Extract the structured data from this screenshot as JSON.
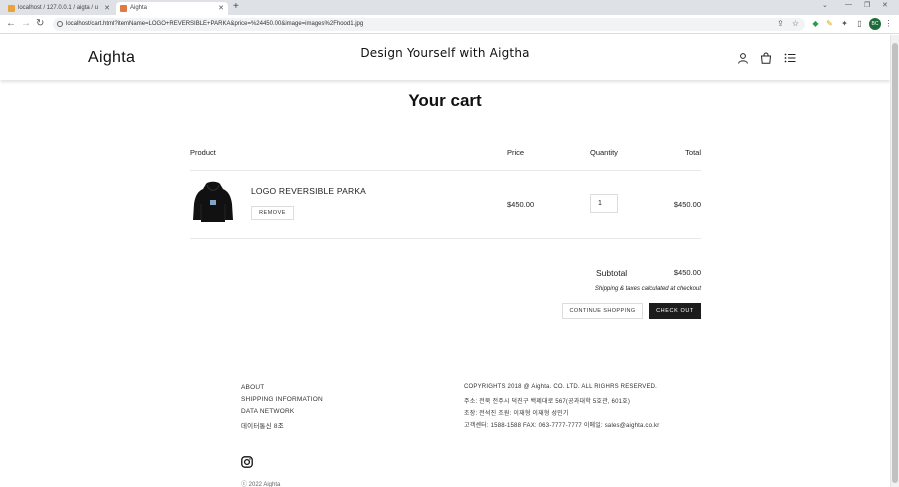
{
  "browser": {
    "tabs": [
      {
        "title": "localhost / 127.0.0.1 / aigta / u",
        "active": false
      },
      {
        "title": "Aighta",
        "active": true
      }
    ],
    "url": "localhost/cart.html?itemName=LOGO+REVERSIBLE+PARKA&price=%24450.00&image=images%2Fhood1.jpg",
    "profile_initials": "BC"
  },
  "header": {
    "logo": "Aighta",
    "tagline": "Design Yourself with Aigtha",
    "icons": [
      "user-icon",
      "bag-icon",
      "menu-list-icon"
    ]
  },
  "cart": {
    "title": "Your cart",
    "columns": {
      "product": "Product",
      "price": "Price",
      "quantity": "Quantity",
      "total": "Total"
    },
    "items": [
      {
        "name": "LOGO REVERSIBLE PARKA",
        "remove_label": "REMOVE",
        "price": "$450.00",
        "quantity": "1",
        "total": "$450.00"
      }
    ],
    "subtotal_label": "Subtotal",
    "subtotal_value": "$450.00",
    "shipping_note": "Shipping & taxes calculated at checkout",
    "continue_label": "CONTINUE SHOPPING",
    "checkout_label": "CHECK OUT"
  },
  "footer": {
    "links": [
      "ABOUT",
      "SHIPPING INFORMATION",
      "DATA NETWORK",
      "데이터통신 8조"
    ],
    "info": [
      "COPYRIGHTS 2018 @ Aighta. CO. LTD. ALL RIGHRS RESERVED.",
      "주소: 전북 전주시 덕진구 백제대로 567(공과대학 5호관, 601호)",
      "조장: 전석진 조원: 이재형 이재형 성민기",
      "고객센터: 1588-1588 FAX: 063-7777-7777 이메일: sales@aighta.co.kr"
    ],
    "copyright": "ⓒ 2022 Aighta"
  },
  "colors": {
    "accent": "#1c1c1c",
    "divider": "#e8e8e8",
    "background": "#ffffff"
  }
}
